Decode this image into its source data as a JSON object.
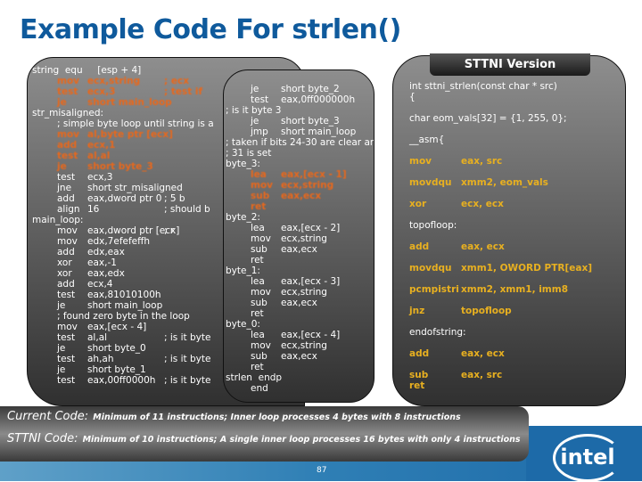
{
  "title": "Example Code For strlen()",
  "current_code": [
    {
      "label": "string  equ     [esp + 4]"
    },
    {
      "op": "mov",
      "args": "ecx,string",
      "comment": "; ecx",
      "hl": true
    },
    {
      "op": "test",
      "args": "ecx,3",
      "comment": "; test if",
      "hl": true
    },
    {
      "op": "je",
      "args": "short main_loop",
      "hl": true
    },
    {
      "label": "str_misaligned:"
    },
    {
      "op": "; simple byte loop until string is a"
    },
    {
      "op": "mov",
      "args": "al,byte ptr [ecx]",
      "hl": true
    },
    {
      "op": "add",
      "args": "ecx,1",
      "hl": true
    },
    {
      "op": "test",
      "args": "al,al",
      "hl": true
    },
    {
      "op": "je",
      "args": "short byte_3",
      "hl": true
    },
    {
      "op": "test",
      "args": "ecx,3"
    },
    {
      "op": "jne",
      "args": "short str_misaligned"
    },
    {
      "op": "add",
      "args": "eax,dword ptr 0",
      "comment": "; 5 b"
    },
    {
      "op": "align",
      "args": "16",
      "comment": "; should b"
    },
    {
      "label": "main_loop:"
    },
    {
      "op": "mov",
      "args": "eax,dword ptr [ecx]",
      "comment": "; r"
    },
    {
      "op": "mov",
      "args": "edx,7efefeffh"
    },
    {
      "op": "add",
      "args": "edx,eax"
    },
    {
      "op": "xor",
      "args": "eax,-1"
    },
    {
      "op": "xor",
      "args": "eax,edx"
    },
    {
      "op": "add",
      "args": "ecx,4"
    },
    {
      "op": "test",
      "args": "eax,81010100h"
    },
    {
      "op": "je",
      "args": "short main_loop"
    },
    {
      "op": "; found zero byte in the loop"
    },
    {
      "op": "mov",
      "args": "eax,[ecx - 4]"
    },
    {
      "op": "test",
      "args": "al,al",
      "comment": "; is it byte"
    },
    {
      "op": "je",
      "args": "short byte_0"
    },
    {
      "op": "test",
      "args": "ah,ah",
      "comment": "; is it byte"
    },
    {
      "op": "je",
      "args": "short byte_1"
    },
    {
      "op": "test",
      "args": "eax,00ff0000h",
      "comment": "; is it byte"
    }
  ],
  "current_code_cont": [
    {
      "op": "je",
      "args": "short byte_2"
    },
    {
      "op": "test",
      "args": "eax,0ff000000h"
    },
    {
      "label": "; is it byte 3"
    },
    {
      "op": "je",
      "args": "short byte_3"
    },
    {
      "op": "jmp",
      "args": "short main_loop"
    },
    {
      "label": "; taken if bits 24-30 are clear and"
    },
    {
      "label": "; 31 is set"
    },
    {
      "label": "byte_3:"
    },
    {
      "op": "lea",
      "args": "eax,[ecx - 1]",
      "hl": true
    },
    {
      "op": "mov",
      "args": "ecx,string",
      "hl": true
    },
    {
      "op": "sub",
      "args": "eax,ecx",
      "hl": true
    },
    {
      "op": "ret",
      "hl": true
    },
    {
      "label": "byte_2:"
    },
    {
      "op": "lea",
      "args": "eax,[ecx - 2]"
    },
    {
      "op": "mov",
      "args": "ecx,string"
    },
    {
      "op": "sub",
      "args": "eax,ecx"
    },
    {
      "op": "ret"
    },
    {
      "label": "byte_1:"
    },
    {
      "op": "lea",
      "args": "eax,[ecx - 3]"
    },
    {
      "op": "mov",
      "args": "ecx,string"
    },
    {
      "op": "sub",
      "args": "eax,ecx"
    },
    {
      "op": "ret"
    },
    {
      "label": "byte_0:"
    },
    {
      "op": "lea",
      "args": "eax,[ecx - 4]"
    },
    {
      "op": "mov",
      "args": "ecx,string"
    },
    {
      "op": "sub",
      "args": "eax,ecx"
    },
    {
      "op": "ret"
    },
    {
      "label": "strlen  endp"
    },
    {
      "op": "end"
    }
  ],
  "sttni": {
    "header": "STTNI Version",
    "lines": [
      {
        "text": "int sttni_strlen(const char * src)"
      },
      {
        "text": "{"
      },
      {
        "text": ""
      },
      {
        "text": "char eom_vals[32] = {1, 255, 0};"
      },
      {
        "text": ""
      },
      {
        "text": "__asm{"
      },
      {
        "text": ""
      },
      {
        "op": "mov",
        "args": "eax, src"
      },
      {
        "text": ""
      },
      {
        "op": "movdqu",
        "args": "xmm2, eom_vals"
      },
      {
        "text": ""
      },
      {
        "op": "xor",
        "args": "ecx, ecx"
      },
      {
        "text": ""
      },
      {
        "text": "topofloop:"
      },
      {
        "text": ""
      },
      {
        "op": "add",
        "args": "eax, ecx"
      },
      {
        "text": ""
      },
      {
        "op": "movdqu",
        "args": "xmm1, OWORD PTR[eax]"
      },
      {
        "text": ""
      },
      {
        "op": "pcmpistri",
        "args": "xmm2, xmm1, imm8"
      },
      {
        "text": ""
      },
      {
        "op": "jnz",
        "args": "topofloop"
      },
      {
        "text": ""
      },
      {
        "text": "endofstring:"
      },
      {
        "text": ""
      },
      {
        "op": "add",
        "args": "eax, ecx"
      },
      {
        "text": ""
      },
      {
        "op": "sub",
        "args": "eax, src"
      },
      {
        "op": "ret",
        "args": ""
      }
    ]
  },
  "summary": {
    "current_label": "Current Code:",
    "current_text": "Minimum of 11 instructions; Inner loop processes 4 bytes with 8 instructions",
    "sttni_label": "STTNI Code:",
    "sttni_text": "Minimum of 10 instructions; A single inner loop processes 16 bytes with only 4 instructions"
  },
  "page_number": "87",
  "logo": "intel",
  "colors": {
    "title": "#0f5a9c",
    "highlight": "#e8681c",
    "sttni_asm": "#e8b020"
  }
}
